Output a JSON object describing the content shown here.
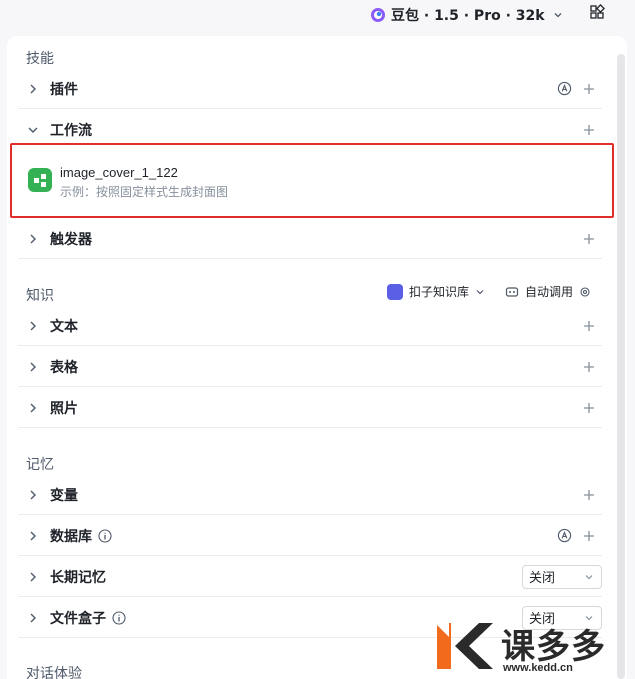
{
  "header": {
    "model_label": "豆包 · 1.5 · Pro · 32k"
  },
  "skills": {
    "title": "技能",
    "plugins_label": "插件",
    "workflow_label": "工作流",
    "workflow_item": {
      "name": "image_cover_1_122",
      "description": "示例：按照固定样式生成封面图"
    },
    "trigger_label": "触发器"
  },
  "knowledge": {
    "title": "知识",
    "kb_source": "扣子知识库",
    "auto_call": "自动调用",
    "text_label": "文本",
    "table_label": "表格",
    "photo_label": "照片"
  },
  "memory": {
    "title": "记忆",
    "variables_label": "变量",
    "database_label": "数据库",
    "long_term_label": "长期记忆",
    "long_term_value": "关闭",
    "filebox_label": "文件盒子",
    "filebox_value": "关闭"
  },
  "dialog": {
    "title": "对话体验"
  },
  "watermark": {
    "brand": "课多多",
    "url": "www.kedd.cn"
  },
  "colors": {
    "highlight": "#e12e2a",
    "workflow_icon": "#35b155",
    "kb_logo": "#5b5fe5"
  }
}
